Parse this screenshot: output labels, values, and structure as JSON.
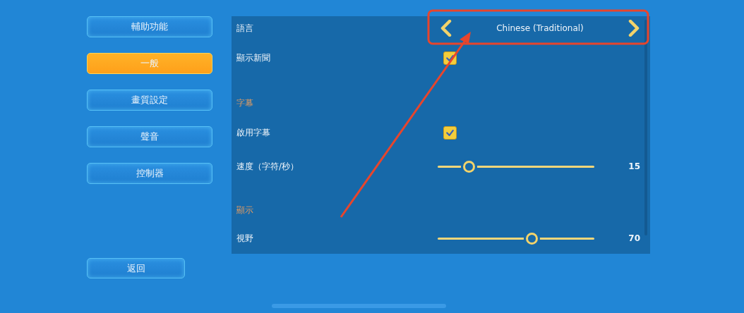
{
  "menu": [
    {
      "label": "輔助功能",
      "selected": false
    },
    {
      "label": "一般",
      "selected": true
    },
    {
      "label": "畫質設定",
      "selected": false
    },
    {
      "label": "聲音",
      "selected": false
    },
    {
      "label": "控制器",
      "selected": false
    }
  ],
  "back_button": "返回",
  "settings": [
    {
      "kind": "selector",
      "label": "語言",
      "value": "Chinese (Traditional)"
    },
    {
      "kind": "checkbox",
      "label": "顯示新聞",
      "checked": true
    },
    {
      "kind": "header",
      "label": "字幕"
    },
    {
      "kind": "checkbox",
      "label": "啟用字幕",
      "checked": true
    },
    {
      "kind": "slider",
      "label": "速度（字符/秒）",
      "level": 0.2,
      "reading": "15"
    },
    {
      "kind": "header",
      "label": "顯示"
    },
    {
      "kind": "slider",
      "label": "視野",
      "level": 0.6,
      "reading": "70"
    }
  ]
}
